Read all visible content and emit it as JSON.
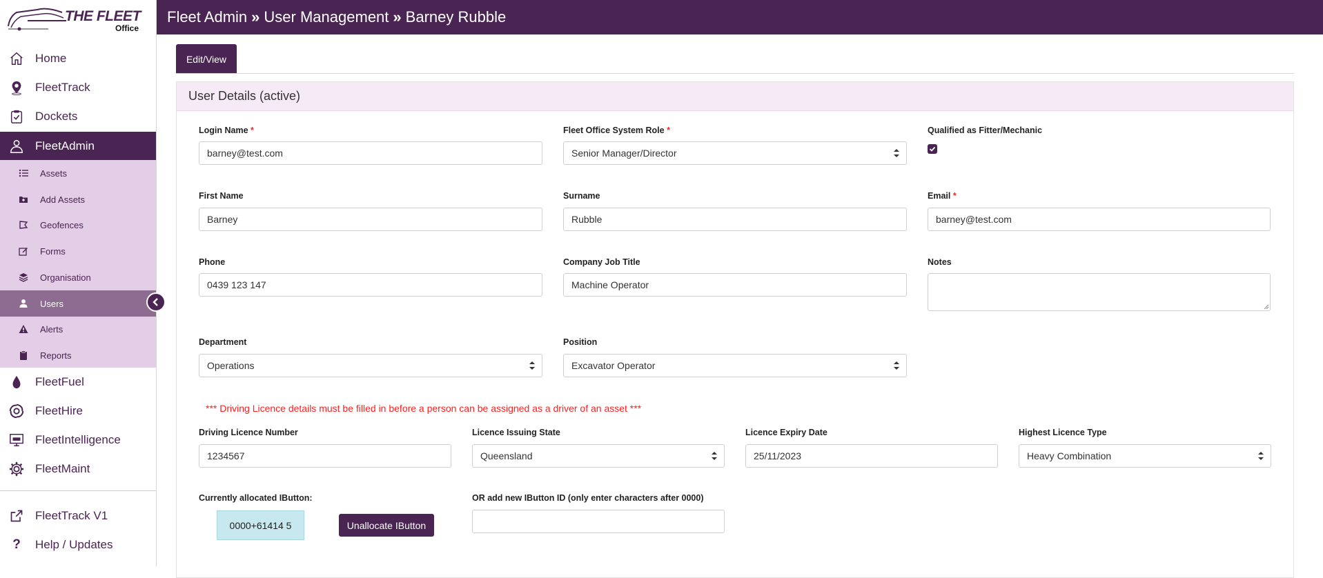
{
  "logo": {
    "line1": "THE FLEET",
    "line2": "Office"
  },
  "header": {
    "crumbs": [
      "Fleet Admin",
      "User Management",
      "Barney Rubble"
    ],
    "separator": "»"
  },
  "nav": {
    "items": [
      {
        "label": "Home",
        "icon": "home-icon"
      },
      {
        "label": "FleetTrack",
        "icon": "map-pin-icon"
      },
      {
        "label": "Dockets",
        "icon": "clipboard-check-icon"
      },
      {
        "label": "FleetAdmin",
        "icon": "user-admin-icon"
      }
    ],
    "sub": [
      {
        "label": "Assets",
        "icon": "list-icon"
      },
      {
        "label": "Add Assets",
        "icon": "folder-plus-icon"
      },
      {
        "label": "Geofences",
        "icon": "geofence-icon"
      },
      {
        "label": "Forms",
        "icon": "edit-icon"
      },
      {
        "label": "Organisation",
        "icon": "layers-icon"
      },
      {
        "label": "Users",
        "icon": "user-icon"
      },
      {
        "label": "Alerts",
        "icon": "warning-icon"
      },
      {
        "label": "Reports",
        "icon": "clipboard-icon"
      }
    ],
    "lower": [
      {
        "label": "FleetFuel",
        "icon": "fuel-drop-icon"
      },
      {
        "label": "FleetHire",
        "icon": "hire-swirl-icon"
      },
      {
        "label": "FleetIntelligence",
        "icon": "monitor-icon"
      },
      {
        "label": "FleetMaint",
        "icon": "gear-icon"
      }
    ],
    "bottom": [
      {
        "label": "FleetTrack V1",
        "icon": "external-link-icon"
      },
      {
        "label": "Help / Updates",
        "icon": "question-icon"
      }
    ]
  },
  "tabs": {
    "edit_view": "Edit/View"
  },
  "card": {
    "title": "User Details (active)"
  },
  "form": {
    "login_name": {
      "label": "Login Name",
      "required": "*",
      "value": "barney@test.com"
    },
    "system_role": {
      "label": "Fleet Office System Role",
      "required": "*",
      "value": "Senior Manager/Director"
    },
    "qualified": {
      "label": "Qualified as Fitter/Mechanic",
      "checked": true
    },
    "first_name": {
      "label": "First Name",
      "value": "Barney"
    },
    "surname": {
      "label": "Surname",
      "value": "Rubble"
    },
    "email": {
      "label": "Email",
      "required": "*",
      "value": "barney@test.com"
    },
    "phone": {
      "label": "Phone",
      "value": "0439 123 147"
    },
    "job_title": {
      "label": "Company Job Title",
      "value": "Machine Operator"
    },
    "notes": {
      "label": "Notes",
      "value": ""
    },
    "department": {
      "label": "Department",
      "value": "Operations"
    },
    "position": {
      "label": "Position",
      "value": "Excavator Operator"
    },
    "licence_warning": "*** Driving Licence details must be filled in before a person can be assigned as a driver of an asset ***",
    "licence_number": {
      "label": "Driving Licence Number",
      "value": "1234567"
    },
    "issuing_state": {
      "label": "Licence Issuing State",
      "value": "Queensland"
    },
    "expiry_date": {
      "label": "Licence Expiry Date",
      "value": "25/11/2023"
    },
    "licence_type": {
      "label": "Highest Licence Type",
      "value": "Heavy Combination"
    },
    "ibutton_current": {
      "label": "Currently allocated IButton:",
      "value": "0000+61414 5"
    },
    "unallocate_button": "Unallocate IButton",
    "ibutton_new": {
      "label": "OR add new IButton ID (only enter characters after 0000)",
      "value": ""
    }
  },
  "colors": {
    "brand": "#4a2452",
    "submenu_bg": "#e4cde6",
    "submenu_active": "#8e6b91",
    "warning": "#ff1e1e"
  }
}
